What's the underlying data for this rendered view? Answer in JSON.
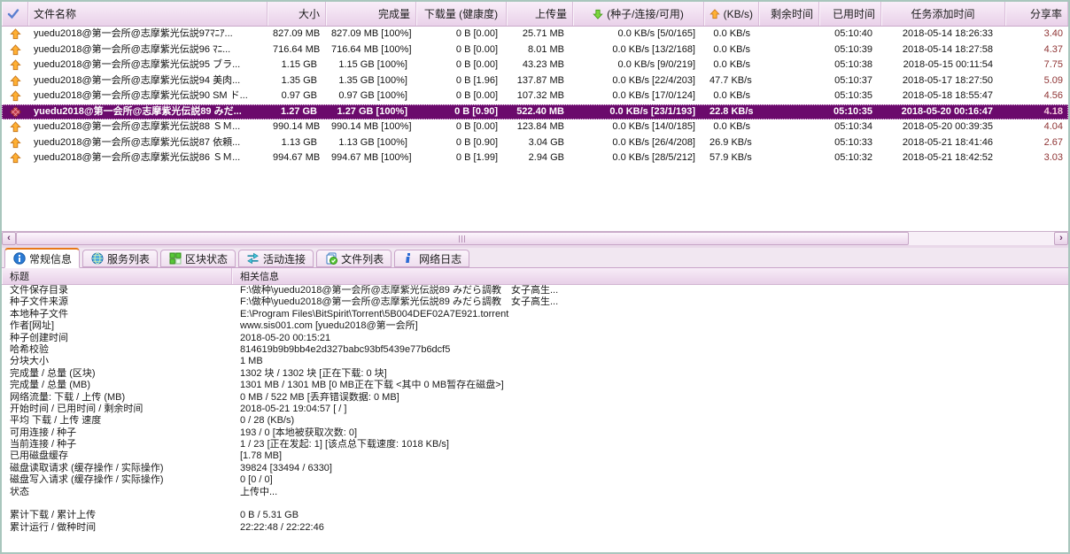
{
  "list": {
    "columns": {
      "check": "",
      "name": "文件名称",
      "size": "大小",
      "done": "完成量",
      "download": "下载量 (健康度)",
      "upload": "上传量",
      "peers": "(种子/连接/可用)",
      "speed": "(KB/s)",
      "remaining": "剩余时间",
      "elapsed": "已用时间",
      "added": "任务添加时间",
      "ratio": "分享率"
    },
    "rows": [
      {
        "icon": "up-arrow-icon",
        "selected": false,
        "name": "yuedu2018@第一会所@志摩紫光伝説97ﾏﾆｱ...",
        "size": "827.09 MB",
        "done": "827.09 MB [100%]",
        "download": "0 B [0.00]",
        "upload": "25.71 MB",
        "peers": "0.0 KB/s [5/0/165]",
        "speed": "0.0 KB/s",
        "remaining": "",
        "elapsed": "05:10:40",
        "added": "2018-05-14 18:26:33",
        "ratio": "3.40"
      },
      {
        "icon": "up-arrow-icon",
        "selected": false,
        "name": "yuedu2018@第一会所@志摩紫光伝説96 ﾏﾆ...",
        "size": "716.64 MB",
        "done": "716.64 MB [100%]",
        "download": "0 B [0.00]",
        "upload": "8.01 MB",
        "peers": "0.0 KB/s [13/2/168]",
        "speed": "0.0 KB/s",
        "remaining": "",
        "elapsed": "05:10:39",
        "added": "2018-05-14 18:27:58",
        "ratio": "4.37"
      },
      {
        "icon": "up-arrow-icon",
        "selected": false,
        "name": "yuedu2018@第一会所@志摩紫光伝説95 ブラ...",
        "size": "1.15 GB",
        "done": "1.15 GB [100%]",
        "download": "0 B [0.00]",
        "upload": "43.23 MB",
        "peers": "0.0 KB/s [9/0/219]",
        "speed": "0.0 KB/s",
        "remaining": "",
        "elapsed": "05:10:38",
        "added": "2018-05-15 00:11:54",
        "ratio": "7.75"
      },
      {
        "icon": "up-arrow-icon",
        "selected": false,
        "name": "yuedu2018@第一会所@志摩紫光伝説94 美肉...",
        "size": "1.35 GB",
        "done": "1.35 GB [100%]",
        "download": "0 B [1.96]",
        "upload": "137.87 MB",
        "peers": "0.0 KB/s [22/4/203]",
        "speed": "47.7 KB/s",
        "remaining": "",
        "elapsed": "05:10:37",
        "added": "2018-05-17 18:27:50",
        "ratio": "5.09"
      },
      {
        "icon": "up-arrow-icon",
        "selected": false,
        "name": "yuedu2018@第一会所@志摩紫光伝説90 SM ド...",
        "size": "0.97 GB",
        "done": "0.97 GB [100%]",
        "download": "0 B [0.00]",
        "upload": "107.32 MB",
        "peers": "0.0 KB/s [17/0/124]",
        "speed": "0.0 KB/s",
        "remaining": "",
        "elapsed": "05:10:35",
        "added": "2018-05-18 18:55:47",
        "ratio": "4.56"
      },
      {
        "icon": "seeding-diamond-icon",
        "selected": true,
        "name": "yuedu2018@第一会所@志摩紫光伝説89 みだ...",
        "size": "1.27 GB",
        "done": "1.27 GB [100%]",
        "download": "0 B [0.90]",
        "upload": "522.40 MB",
        "peers": "0.0 KB/s [23/1/193]",
        "speed": "22.8 KB/s",
        "remaining": "",
        "elapsed": "05:10:35",
        "added": "2018-05-20 00:16:47",
        "ratio": "4.18"
      },
      {
        "icon": "up-arrow-icon",
        "selected": false,
        "name": "yuedu2018@第一会所@志摩紫光伝説88 ＳＭ...",
        "size": "990.14 MB",
        "done": "990.14 MB [100%]",
        "download": "0 B [0.00]",
        "upload": "123.84 MB",
        "peers": "0.0 KB/s [14/0/185]",
        "speed": "0.0 KB/s",
        "remaining": "",
        "elapsed": "05:10:34",
        "added": "2018-05-20 00:39:35",
        "ratio": "4.04"
      },
      {
        "icon": "up-arrow-icon",
        "selected": false,
        "name": "yuedu2018@第一会所@志摩紫光伝説87 依頼...",
        "size": "1.13 GB",
        "done": "1.13 GB [100%]",
        "download": "0 B [0.90]",
        "upload": "3.04 GB",
        "peers": "0.0 KB/s [26/4/208]",
        "speed": "26.9 KB/s",
        "remaining": "",
        "elapsed": "05:10:33",
        "added": "2018-05-21 18:41:46",
        "ratio": "2.67"
      },
      {
        "icon": "up-arrow-icon",
        "selected": false,
        "name": "yuedu2018@第一会所@志摩紫光伝説86 ＳＭ...",
        "size": "994.67 MB",
        "done": "994.67 MB [100%]",
        "download": "0 B [1.99]",
        "upload": "2.94 GB",
        "peers": "0.0 KB/s [28/5/212]",
        "speed": "57.9 KB/s",
        "remaining": "",
        "elapsed": "05:10:32",
        "added": "2018-05-21 18:42:52",
        "ratio": "3.03"
      }
    ]
  },
  "scrollbar": {
    "left_arrow": "‹",
    "right_arrow": "›"
  },
  "tabs": [
    {
      "label": "常规信息",
      "icon": "info-icon",
      "active": true
    },
    {
      "label": "服务列表",
      "icon": "globe-icon",
      "active": false
    },
    {
      "label": "区块状态",
      "icon": "blocks-icon",
      "active": false
    },
    {
      "label": "活动连接",
      "icon": "connections-icon",
      "active": false
    },
    {
      "label": "文件列表",
      "icon": "filelist-icon",
      "active": false
    },
    {
      "label": "网络日志",
      "icon": "log-icon",
      "active": false
    }
  ],
  "details": {
    "headers": {
      "title": "标题",
      "info": "相关信息"
    },
    "rows": [
      {
        "label": "文件保存目录",
        "value": "F:\\做种\\yuedu2018@第一会所@志摩紫光伝説89 みだら調教　女子高生..."
      },
      {
        "label": "种子文件来源",
        "value": "F:\\做种\\yuedu2018@第一会所@志摩紫光伝説89 みだら調教　女子高生..."
      },
      {
        "label": "本地种子文件",
        "value": "E:\\Program Files\\BitSpirit\\Torrent\\5B004DEF02A7E921.torrent"
      },
      {
        "label": "作者[网址]",
        "value": "www.sis001.com [yuedu2018@第一会所]"
      },
      {
        "label": "种子创建时间",
        "value": "2018-05-20 00:15:21"
      },
      {
        "label": "哈希校验",
        "value": "814619b9b9bb4e2d327babc93bf5439e77b6dcf5"
      },
      {
        "label": "分块大小",
        "value": "1 MB"
      },
      {
        "label": "完成量 / 总量 (区块)",
        "value": "1302 块 / 1302 块 [正在下载: 0 块]"
      },
      {
        "label": "完成量 / 总量 (MB)",
        "value": "1301 MB / 1301 MB [0 MB正在下载 <其中 0 MB暂存在磁盘>]"
      },
      {
        "label": "网络流量: 下载 / 上传 (MB)",
        "value": "0 MB / 522 MB [丢弃错误数据: 0 MB]"
      },
      {
        "label": "开始时间 / 已用时间 / 剩余时间",
        "value": "2018-05-21 19:04:57 [ / ]"
      },
      {
        "label": "平均 下载 / 上传 速度",
        "value": "0 / 28 (KB/s)"
      },
      {
        "label": "可用连接 / 种子",
        "value": "193 / 0 [本地被获取次数: 0]"
      },
      {
        "label": "当前连接 / 种子",
        "value": "1 / 23 [正在发起: 1] [该点总下载速度: 1018 KB/s]"
      },
      {
        "label": "已用磁盘缓存",
        "value": "[1.78 MB]"
      },
      {
        "label": "磁盘读取请求 (缓存操作 / 实际操作)",
        "value": "39824 [33494 / 6330]"
      },
      {
        "label": "磁盘写入请求 (缓存操作 / 实际操作)",
        "value": "0 [0 / 0]"
      },
      {
        "label": "状态",
        "value": "上传中..."
      },
      {
        "label": "",
        "value": ""
      },
      {
        "label": "累计下载 / 累计上传",
        "value": "0 B / 5.31 GB"
      },
      {
        "label": "累计运行 / 做种时间",
        "value": "22:22:48 / 22:22:46"
      }
    ]
  },
  "colors": {
    "selected_row_bg": "#6B0A6C",
    "ratio_text": "#8F3434",
    "active_tab_accent": "#E87818",
    "header_bg": "#EFD9EE",
    "window_border": "#A9C6BD"
  }
}
